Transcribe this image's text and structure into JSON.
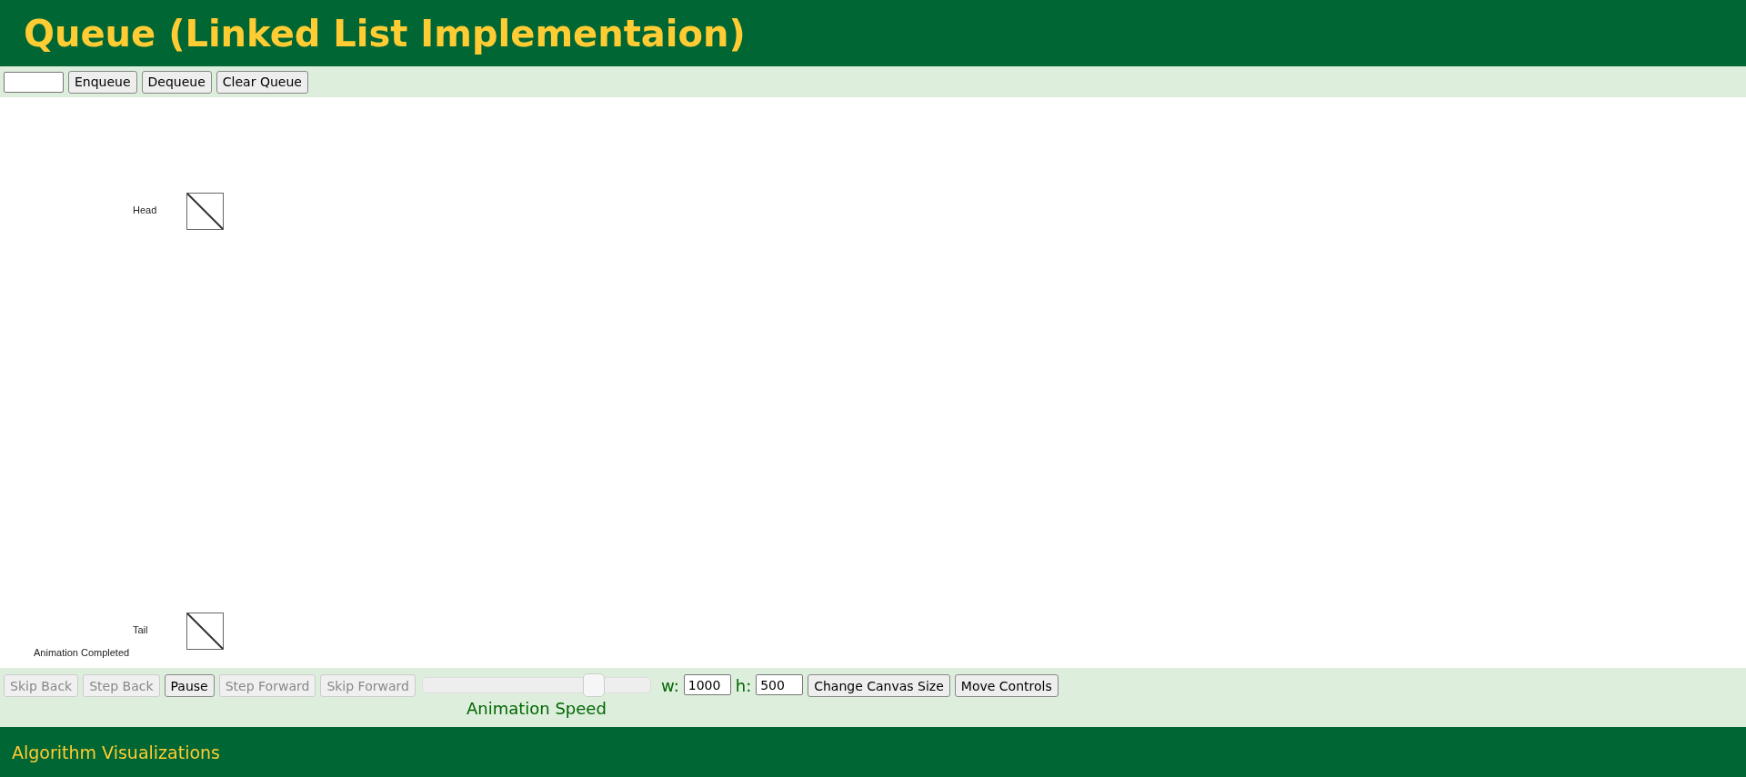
{
  "header": {
    "title": "Queue (Linked List Implementaion)"
  },
  "top_controls": {
    "buttons": [
      {
        "label": "Enqueue",
        "disabled": false
      },
      {
        "label": "Dequeue",
        "disabled": false
      },
      {
        "label": "Clear Queue",
        "disabled": false
      }
    ]
  },
  "canvas": {
    "pointers": [
      {
        "label": "Head",
        "kind": "head"
      },
      {
        "label": "Tail",
        "kind": "tail"
      }
    ],
    "status": "Animation Completed"
  },
  "bottom_controls": {
    "buttons": [
      {
        "label": "Skip Back",
        "disabled": true
      },
      {
        "label": "Step Back",
        "disabled": true
      },
      {
        "label": "Pause",
        "disabled": false
      },
      {
        "label": "Step Forward",
        "disabled": true
      },
      {
        "label": "Skip Forward",
        "disabled": true
      }
    ],
    "speed": {
      "label": "Animation Speed",
      "level": 0.75
    },
    "width": {
      "label": "w:",
      "value": "1000"
    },
    "height": {
      "label": "h:",
      "value": "500"
    },
    "actions": [
      {
        "label": "Change Canvas Size",
        "disabled": false
      },
      {
        "label": "Move Controls",
        "disabled": false
      }
    ]
  },
  "footer": {
    "text": "Algorithm Visualizations"
  }
}
